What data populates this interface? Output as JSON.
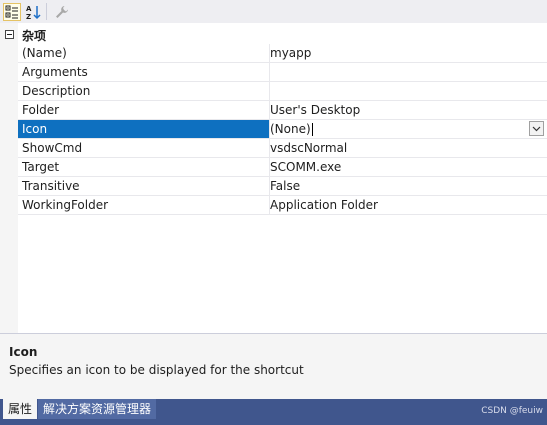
{
  "toolbar": {
    "buttons": [
      {
        "name": "categorized",
        "icon": "categorized-icon",
        "active": true
      },
      {
        "name": "alphabetical",
        "icon": "sort-az-icon",
        "active": false
      },
      {
        "name": "property-pages",
        "icon": "wrench-icon",
        "active": false
      }
    ]
  },
  "grid": {
    "category": "杂项",
    "rows": [
      {
        "name": "(Name)",
        "value": "myapp"
      },
      {
        "name": "Arguments",
        "value": ""
      },
      {
        "name": "Description",
        "value": ""
      },
      {
        "name": "Folder",
        "value": "User's Desktop"
      },
      {
        "name": "Icon",
        "value": "(None)"
      },
      {
        "name": "ShowCmd",
        "value": "vsdscNormal"
      },
      {
        "name": "Target",
        "value": "SCOMM.exe"
      },
      {
        "name": "Transitive",
        "value": "False"
      },
      {
        "name": "WorkingFolder",
        "value": "Application Folder"
      }
    ]
  },
  "description": {
    "title": "Icon",
    "text": "Specifies an icon to be displayed for the shortcut"
  },
  "tabs": {
    "properties": "属性",
    "solution_explorer": "解决方案资源管理器"
  },
  "watermark": "CSDN @feuiw",
  "colors": {
    "selection": "#0e70c0",
    "tabbar": "#40568d"
  }
}
